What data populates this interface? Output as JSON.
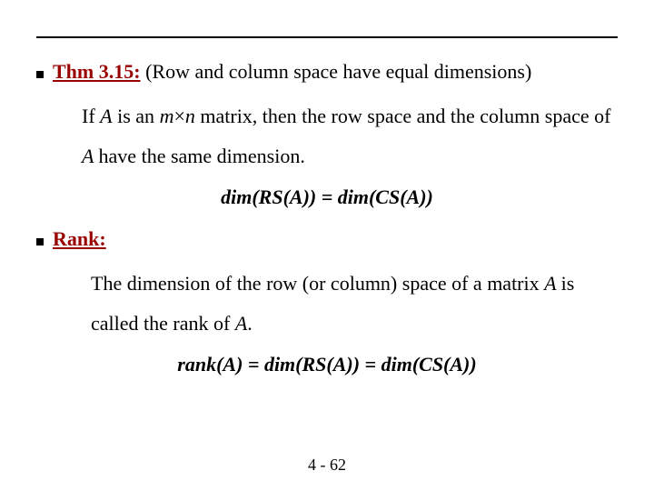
{
  "section1": {
    "label": "Thm 3.15:",
    "subtitle": " (Row and column space have equal dimensions)",
    "body_pre": "If ",
    "body_A1": "A",
    "body_mid1": " is an ",
    "body_m": "m",
    "body_times": "×",
    "body_n": "n",
    "body_mid2": " matrix, then the row space and the column space of  ",
    "body_A2": "A ",
    "body_tail": "have the same dimension.",
    "equation": "dim(RS(A)) = dim(CS(A))"
  },
  "section2": {
    "label": "Rank:",
    "body_pre": "The dimension of the row (or column) space of a matrix ",
    "body_A1": "A ",
    "body_mid": "is called the rank of  ",
    "body_A2": "A",
    "body_tail": ".",
    "equation": "rank(A) = dim(RS(A)) = dim(CS(A))"
  },
  "footer": {
    "text": "4 - 62"
  }
}
